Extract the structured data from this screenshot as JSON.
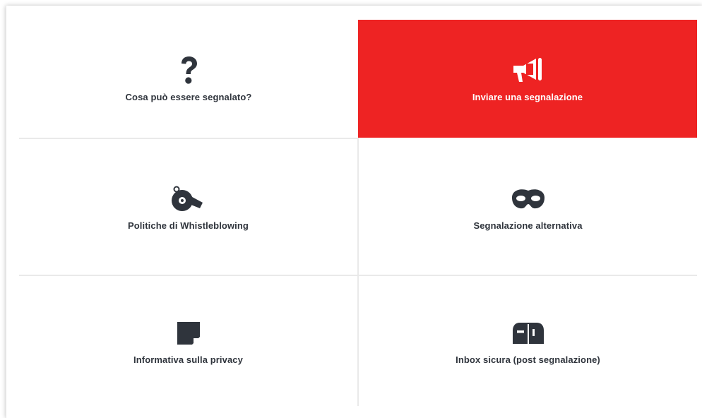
{
  "tiles": [
    {
      "label": "Cosa può essere segnalato?",
      "icon": "question-icon",
      "active": false
    },
    {
      "label": "Inviare una segnalazione",
      "icon": "megaphone-icon",
      "active": true
    },
    {
      "label": "Politiche di Whistleblowing",
      "icon": "whistle-icon",
      "active": false
    },
    {
      "label": "Segnalazione alternativa",
      "icon": "mask-icon",
      "active": false
    },
    {
      "label": "Informativa sulla privacy",
      "icon": "note-icon",
      "active": false
    },
    {
      "label": "Inbox sicura (post segnalazione)",
      "icon": "mailbox-icon",
      "active": false
    }
  ],
  "colors": {
    "accent": "#ee2323",
    "icon": "#2f343c",
    "divider": "#e9e9e9"
  }
}
